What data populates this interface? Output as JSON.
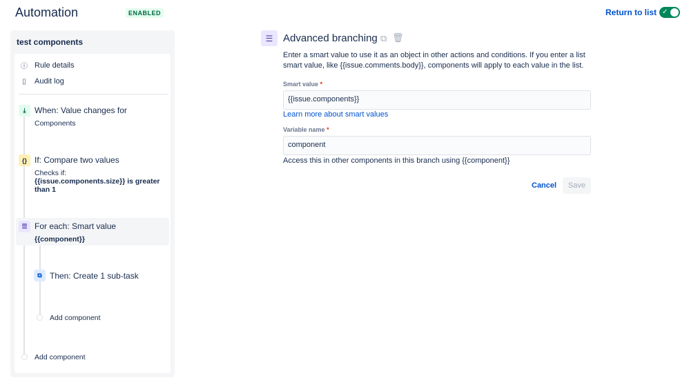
{
  "header": {
    "title": "Automation",
    "status_badge": "ENABLED",
    "return_link": "Return to list",
    "toggle_on": true
  },
  "sidebar": {
    "rule_name": "test components",
    "nav": [
      {
        "label": "Rule details",
        "icon": "info-icon"
      },
      {
        "label": "Audit log",
        "icon": "document-icon"
      }
    ],
    "steps": {
      "trigger_title": "When: Value changes for",
      "trigger_sub": "Components",
      "condition_title": "If: Compare two values",
      "condition_sub1": "Checks if:",
      "condition_sub2": "{{issue.components.size}} is greater than 1",
      "branch_title": "For each: Smart value",
      "branch_sub": "{{component}}",
      "action_title": "Then: Create 1 sub-task",
      "add_inner": "Add component",
      "add_outer": "Add component"
    }
  },
  "panel": {
    "title": "Advanced branching",
    "description": "Enter a smart value to use it as an object in other actions and conditions. If you enter a list smart value, like {{issue.comments.body}}, components will apply to each value in the list.",
    "smart_value_label": "Smart value",
    "smart_value": "{{issue.components}}",
    "learn_more": "Learn more about smart values",
    "variable_label": "Variable name",
    "variable_value": "component",
    "variable_help": "Access this in other components in this branch using {{component}}",
    "required_mark": "*",
    "cancel": "Cancel",
    "save": "Save"
  },
  "colors": {
    "accent": "#0052cc",
    "enabled": "#00875a"
  }
}
